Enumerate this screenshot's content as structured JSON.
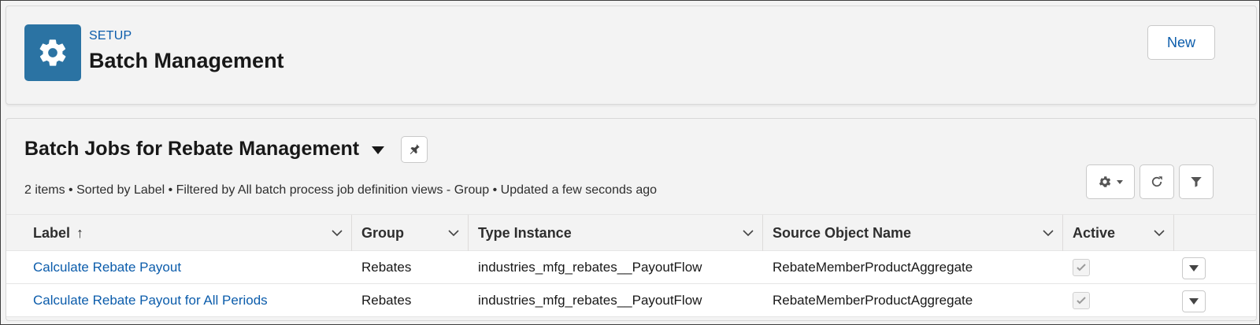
{
  "header": {
    "eyebrow": "SETUP",
    "title": "Batch Management",
    "new_button": "New",
    "icon": "gear-icon",
    "tile_color": "#2b73a3"
  },
  "list_view": {
    "title": "Batch Jobs for Rebate Management",
    "meta": "2 items • Sorted by Label • Filtered by All batch process job definition views - Group • Updated a few seconds ago",
    "tools": [
      "settings-gear-icon",
      "refresh-icon",
      "filter-icon"
    ]
  },
  "table": {
    "columns": [
      {
        "label": "Label",
        "sort": "↑"
      },
      {
        "label": "Group"
      },
      {
        "label": "Type Instance"
      },
      {
        "label": "Source Object Name"
      },
      {
        "label": "Active"
      }
    ],
    "rows": [
      {
        "label": "Calculate Rebate Payout",
        "group": "Rebates",
        "type_instance": "industries_mfg_rebates__PayoutFlow",
        "source_object": "RebateMemberProductAggregate",
        "active": true
      },
      {
        "label": "Calculate Rebate Payout for All Periods",
        "group": "Rebates",
        "type_instance": "industries_mfg_rebates__PayoutFlow",
        "source_object": "RebateMemberProductAggregate",
        "active": true
      }
    ]
  },
  "colors": {
    "link": "#0b5cab",
    "text": "#181818",
    "background": "#f3f3f3"
  }
}
